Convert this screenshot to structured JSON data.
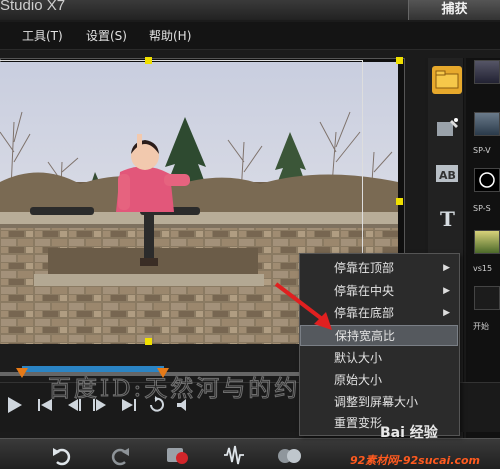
{
  "window": {
    "title_fragment": "Studio X7"
  },
  "header": {
    "capture_tab": "捕获"
  },
  "menu": {
    "tools": "工具(T)",
    "settings": "设置(S)",
    "help": "帮助(H)"
  },
  "context_menu": {
    "items": [
      {
        "label": "停靠在顶部",
        "submenu": true
      },
      {
        "label": "停靠在中央",
        "submenu": true
      },
      {
        "label": "停靠在底部",
        "submenu": true
      },
      {
        "label": "保持宽高比",
        "submenu": false,
        "highlighted": true
      },
      {
        "label": "默认大小",
        "submenu": false
      },
      {
        "label": "原始大小",
        "submenu": false
      },
      {
        "label": "调整到屏幕大小",
        "submenu": false
      },
      {
        "label": "重置变形",
        "submenu": false
      }
    ]
  },
  "library": {
    "thumb_labels": [
      "SP-V",
      "SP-S",
      "vs15",
      "开始"
    ]
  },
  "watermark": {
    "text": "百度ID:天然河与的约",
    "baidu": "Bai 经验",
    "site": "92素材网-92sucai.com"
  },
  "colors": {
    "accent_blue": "#2b84c4",
    "handle_yellow": "#f0e000",
    "arrow_red": "#e02020"
  },
  "icons": [
    "folder-icon",
    "effects-icon",
    "title-ab-icon",
    "text-t-icon",
    "play-icon",
    "rewind-icon",
    "prev-frame-icon",
    "next-frame-icon",
    "forward-icon",
    "repeat-icon",
    "volume-icon",
    "undo-icon",
    "redo-icon",
    "record-icon",
    "audio-icon"
  ]
}
